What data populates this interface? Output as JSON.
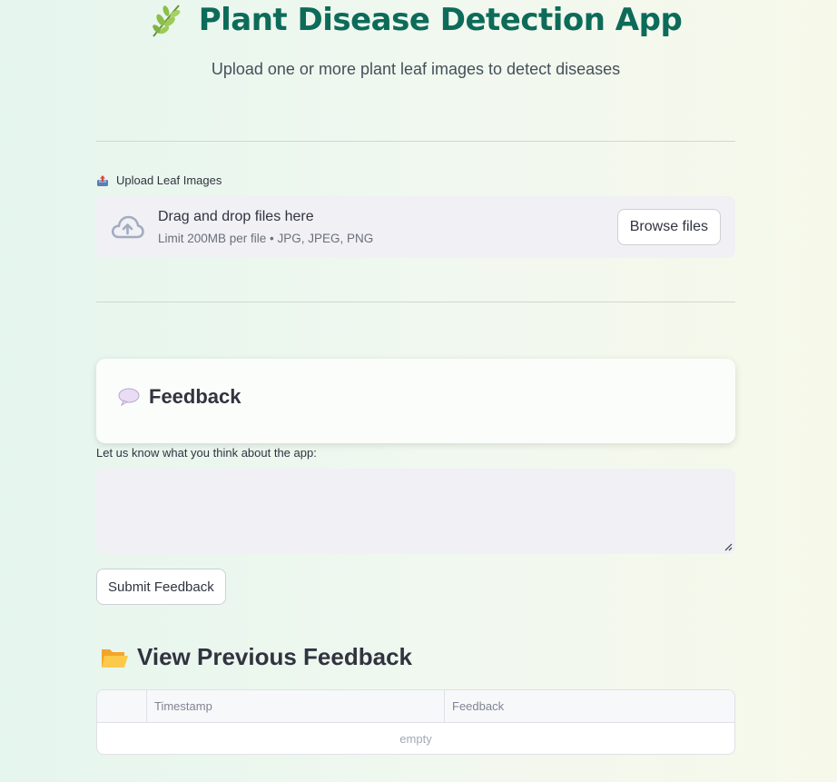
{
  "header": {
    "title": "Plant Disease Detection App",
    "title_icon": "herb-icon",
    "subtitle": "Upload one or more plant leaf images to detect diseases"
  },
  "uploader": {
    "label": "Upload Leaf Images",
    "label_icon": "outbox-tray-icon",
    "drop_title": "Drag and drop files here",
    "drop_subtitle": "Limit 200MB per file • JPG, JPEG, PNG",
    "browse_label": "Browse files"
  },
  "feedback": {
    "card_title": "Feedback",
    "card_icon": "speech-balloon-icon",
    "prompt": "Let us know what you think about the app:",
    "textarea_value": "",
    "submit_label": "Submit Feedback"
  },
  "previous": {
    "title": "View Previous Feedback",
    "icon": "open-folder-icon",
    "columns": [
      "",
      "Timestamp",
      "Feedback"
    ],
    "rows": [],
    "empty_text": "empty"
  },
  "colors": {
    "title": "#0d6b59",
    "accent_gradient_start": "#e5f6ee",
    "accent_gradient_end": "#f6f9ea"
  }
}
